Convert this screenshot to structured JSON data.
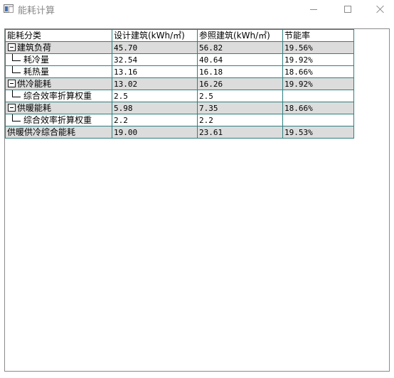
{
  "window": {
    "title": "能耗计算",
    "icon": "app-window-icon"
  },
  "table": {
    "columns": [
      "能耗分类",
      "设计建筑(kWh/㎡)",
      "参照建筑(kWh/㎡)",
      "节能率"
    ],
    "rows": [
      {
        "label": "建筑负荷",
        "design": "45.70",
        "reference": "56.82",
        "rate": "19.56%"
      },
      {
        "label": "耗冷量",
        "design": "32.54",
        "reference": "40.64",
        "rate": "19.92%"
      },
      {
        "label": "耗热量",
        "design": "13.16",
        "reference": "16.18",
        "rate": "18.66%"
      },
      {
        "label": "供冷能耗",
        "design": "13.02",
        "reference": "16.26",
        "rate": "19.92%"
      },
      {
        "label": "综合效率折算权重",
        "design": "2.5",
        "reference": "2.5",
        "rate": ""
      },
      {
        "label": "供暖能耗",
        "design": "5.98",
        "reference": "7.35",
        "rate": "18.66%"
      },
      {
        "label": "综合效率折算权重",
        "design": "2.2",
        "reference": "2.2",
        "rate": ""
      },
      {
        "label": "供暖供冷综合能耗",
        "design": "19.00",
        "reference": "23.61",
        "rate": "19.53%"
      }
    ]
  }
}
